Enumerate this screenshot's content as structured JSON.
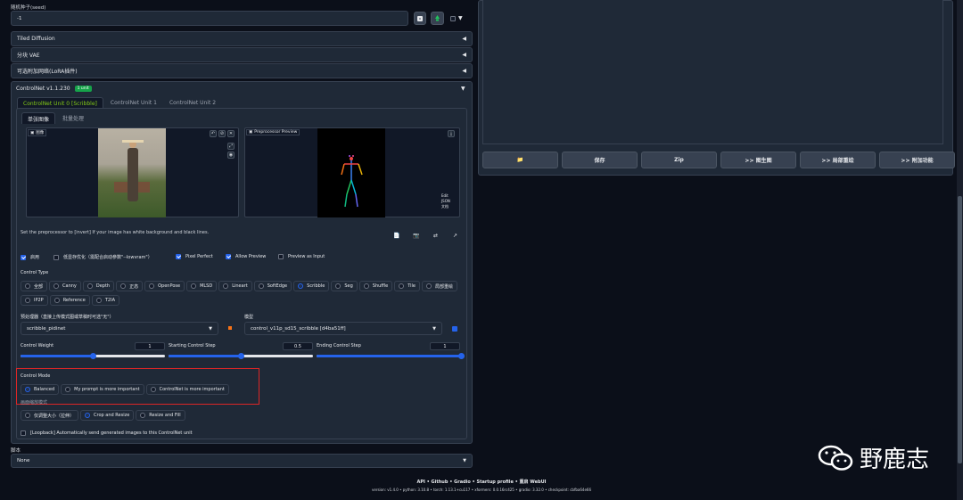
{
  "seed": {
    "label": "随机种子(seed)",
    "value": "-1"
  },
  "accordions": [
    {
      "title": "Tiled Diffusion",
      "arrow": "◀"
    },
    {
      "title": "分块 VAE",
      "arrow": "◀"
    },
    {
      "title": "可选附加网络(LoRA插件)",
      "arrow": "◀"
    }
  ],
  "controlnet": {
    "title": "ControlNet v1.1.230",
    "badge": "1 unit",
    "arrow": "▼",
    "unit_tabs": [
      "ControlNet Unit 0 [Scribble]",
      "ControlNet Unit 1",
      "ControlNet Unit 2"
    ],
    "image_tabs": [
      "单张图像",
      "批量处理"
    ],
    "image_label": "图像",
    "preview_label": "Preprocessor Preview",
    "preview_buttons": [
      "Edit",
      "JSON",
      "文档"
    ],
    "hint": "Set the preprocessor to [invert] If your image has white background and black lines.",
    "checkboxes": [
      {
        "label": "启用",
        "checked": true
      },
      {
        "label": "低显存优化（需配合启动参数\"--lowvram\"）",
        "checked": false
      },
      {
        "label": "Pixel Perfect",
        "checked": true
      },
      {
        "label": "Allow Preview",
        "checked": true
      },
      {
        "label": "Preview as Input",
        "checked": false
      }
    ],
    "control_type_label": "Control Type",
    "control_types_row1": [
      "全部",
      "Canny",
      "Depth",
      "正态",
      "OpenPose",
      "MLSD",
      "Lineart",
      "SoftEdge",
      "Scribble",
      "Seg",
      "Shuffle",
      "Tile",
      "局部重绘"
    ],
    "control_types_row2": [
      "IP2P",
      "Reference",
      "T2IA"
    ],
    "control_type_selected": "Scribble",
    "preprocessor_label": "预处理器（直接上传模式图或草稿时可选\"无\"）",
    "preprocessor_value": "scribble_pidinet",
    "model_label": "模型",
    "model_value": "control_v11p_sd15_scribble [d4ba51ff]",
    "sliders": [
      {
        "label": "Control Weight",
        "value": "1",
        "fraction": 0.5
      },
      {
        "label": "Starting Control Step",
        "value": "0.5",
        "fraction": 0.5
      },
      {
        "label": "Ending Control Step",
        "value": "1",
        "fraction": 1.0
      }
    ],
    "control_mode_label": "Control Mode",
    "control_modes": [
      "Balanced",
      "My prompt is more important",
      "ControlNet is more important"
    ],
    "control_mode_selected": "Balanced",
    "resize_label": "画面缩放模式",
    "resize_modes": [
      "仅调整大小（拉伸）",
      "Crop and Resize",
      "Resize and Fill"
    ],
    "resize_selected": "Crop and Resize",
    "loopback_label": "[Loopback] Automatically send generated images to this ControlNet unit"
  },
  "script": {
    "label": "脚本",
    "value": "None"
  },
  "output_buttons": [
    "📁",
    "保存",
    "Zip",
    ">> 图生图",
    ">> 局部重绘",
    ">> 附加功能"
  ],
  "footer": {
    "links": "API  •  Github  •  Gradio  •  Startup profile  •  重启 WebUI",
    "versions": "version: v1.4.0  •  python: 3.10.8  •  torch: 1.13.1+cu117  •  xformers: 0.0.16rc425  •  gradio: 3.32.0  •  checkpoint: cbfba64e66"
  },
  "watermark": "野鹿志",
  "colors": {
    "bg": "#0b0f19",
    "panel": "#1f2937",
    "accent": "#2563eb",
    "green": "#84cc16",
    "highlight": "#dc2626"
  }
}
